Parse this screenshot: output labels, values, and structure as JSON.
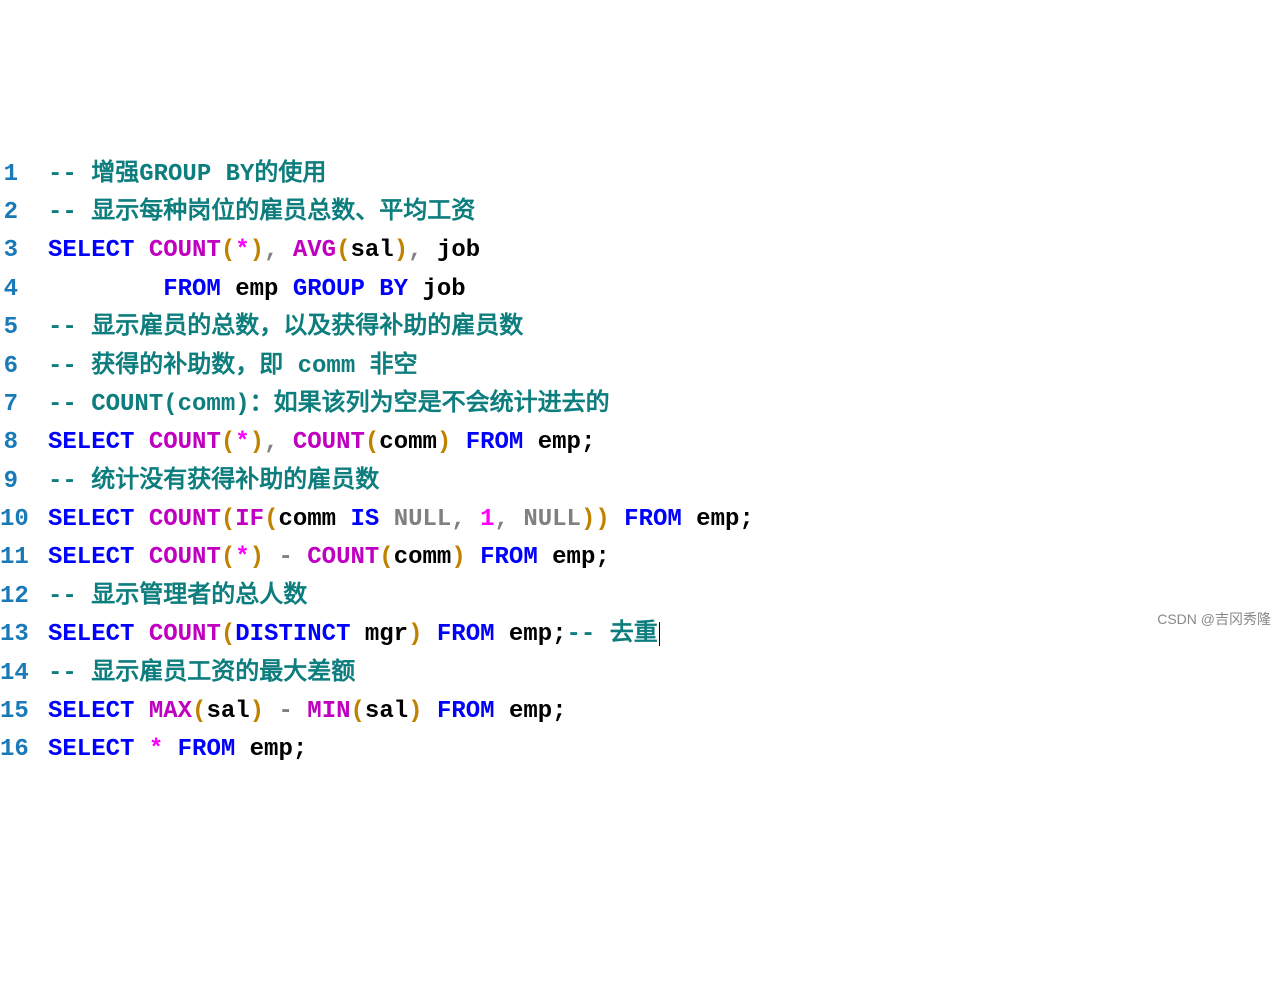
{
  "watermark": "CSDN @吉冈秀隆",
  "lines": [
    {
      "num": "1",
      "tokens": [
        {
          "cls": "comment",
          "t": "-- 增强GROUP BY的使用"
        }
      ]
    },
    {
      "num": "2",
      "tokens": [
        {
          "cls": "comment",
          "t": "-- 显示每种岗位的雇员总数、平均工资"
        }
      ]
    },
    {
      "num": "3",
      "tokens": [
        {
          "cls": "keyword",
          "t": "SELECT"
        },
        {
          "cls": "ident",
          "t": " "
        },
        {
          "cls": "func",
          "t": "COUNT"
        },
        {
          "cls": "paren",
          "t": "("
        },
        {
          "cls": "star",
          "t": "*"
        },
        {
          "cls": "paren",
          "t": ")"
        },
        {
          "cls": "op",
          "t": ", "
        },
        {
          "cls": "func",
          "t": "AVG"
        },
        {
          "cls": "paren",
          "t": "("
        },
        {
          "cls": "ident",
          "t": "sal"
        },
        {
          "cls": "paren",
          "t": ")"
        },
        {
          "cls": "op",
          "t": ", "
        },
        {
          "cls": "ident",
          "t": "job"
        }
      ]
    },
    {
      "num": "4",
      "tokens": [
        {
          "cls": "ident",
          "t": "        "
        },
        {
          "cls": "keyword",
          "t": "FROM"
        },
        {
          "cls": "ident",
          "t": " emp "
        },
        {
          "cls": "keyword",
          "t": "GROUP"
        },
        {
          "cls": "ident",
          "t": " "
        },
        {
          "cls": "keyword",
          "t": "BY"
        },
        {
          "cls": "ident",
          "t": " job"
        }
      ]
    },
    {
      "num": "5",
      "tokens": [
        {
          "cls": "comment",
          "t": "-- 显示雇员的总数，以及获得补助的雇员数"
        }
      ]
    },
    {
      "num": "6",
      "tokens": [
        {
          "cls": "comment",
          "t": "-- 获得的补助数，即 comm 非空"
        }
      ]
    },
    {
      "num": "7",
      "tokens": [
        {
          "cls": "comment",
          "t": "-- COUNT(comm)：如果该列为空是不会统计进去的"
        }
      ]
    },
    {
      "num": "8",
      "tokens": [
        {
          "cls": "keyword",
          "t": "SELECT"
        },
        {
          "cls": "ident",
          "t": " "
        },
        {
          "cls": "func",
          "t": "COUNT"
        },
        {
          "cls": "paren",
          "t": "("
        },
        {
          "cls": "star",
          "t": "*"
        },
        {
          "cls": "paren",
          "t": ")"
        },
        {
          "cls": "op",
          "t": ", "
        },
        {
          "cls": "func",
          "t": "COUNT"
        },
        {
          "cls": "paren",
          "t": "("
        },
        {
          "cls": "ident",
          "t": "comm"
        },
        {
          "cls": "paren",
          "t": ")"
        },
        {
          "cls": "ident",
          "t": " "
        },
        {
          "cls": "keyword",
          "t": "FROM"
        },
        {
          "cls": "ident",
          "t": " emp"
        },
        {
          "cls": "punct",
          "t": ";"
        }
      ]
    },
    {
      "num": "9",
      "tokens": [
        {
          "cls": "comment",
          "t": "-- 统计没有获得补助的雇员数"
        }
      ]
    },
    {
      "num": "10",
      "tokens": [
        {
          "cls": "keyword",
          "t": "SELECT"
        },
        {
          "cls": "ident",
          "t": " "
        },
        {
          "cls": "func",
          "t": "COUNT"
        },
        {
          "cls": "paren",
          "t": "("
        },
        {
          "cls": "func",
          "t": "IF"
        },
        {
          "cls": "paren",
          "t": "("
        },
        {
          "cls": "ident",
          "t": "comm "
        },
        {
          "cls": "keyword",
          "t": "IS"
        },
        {
          "cls": "ident",
          "t": " "
        },
        {
          "cls": "null",
          "t": "NULL"
        },
        {
          "cls": "op",
          "t": ", "
        },
        {
          "cls": "num",
          "t": "1"
        },
        {
          "cls": "op",
          "t": ", "
        },
        {
          "cls": "null",
          "t": "NULL"
        },
        {
          "cls": "paren",
          "t": "))"
        },
        {
          "cls": "ident",
          "t": " "
        },
        {
          "cls": "keyword",
          "t": "FROM"
        },
        {
          "cls": "ident",
          "t": " emp"
        },
        {
          "cls": "punct",
          "t": ";"
        }
      ]
    },
    {
      "num": "11",
      "tokens": [
        {
          "cls": "keyword",
          "t": "SELECT"
        },
        {
          "cls": "ident",
          "t": " "
        },
        {
          "cls": "func",
          "t": "COUNT"
        },
        {
          "cls": "paren",
          "t": "("
        },
        {
          "cls": "star",
          "t": "*"
        },
        {
          "cls": "paren",
          "t": ")"
        },
        {
          "cls": "ident",
          "t": " "
        },
        {
          "cls": "op",
          "t": "-"
        },
        {
          "cls": "ident",
          "t": " "
        },
        {
          "cls": "func",
          "t": "COUNT"
        },
        {
          "cls": "paren",
          "t": "("
        },
        {
          "cls": "ident",
          "t": "comm"
        },
        {
          "cls": "paren",
          "t": ")"
        },
        {
          "cls": "ident",
          "t": " "
        },
        {
          "cls": "keyword",
          "t": "FROM"
        },
        {
          "cls": "ident",
          "t": " emp"
        },
        {
          "cls": "punct",
          "t": ";"
        }
      ]
    },
    {
      "num": "12",
      "tokens": [
        {
          "cls": "comment",
          "t": "-- 显示管理者的总人数"
        }
      ]
    },
    {
      "num": "13",
      "tokens": [
        {
          "cls": "keyword",
          "t": "SELECT"
        },
        {
          "cls": "ident",
          "t": " "
        },
        {
          "cls": "func",
          "t": "COUNT"
        },
        {
          "cls": "paren",
          "t": "("
        },
        {
          "cls": "keyword",
          "t": "DISTINCT"
        },
        {
          "cls": "ident",
          "t": " mgr"
        },
        {
          "cls": "paren",
          "t": ")"
        },
        {
          "cls": "ident",
          "t": " "
        },
        {
          "cls": "keyword",
          "t": "FROM"
        },
        {
          "cls": "ident",
          "t": " emp"
        },
        {
          "cls": "punct",
          "t": ";"
        },
        {
          "cls": "comment",
          "t": "-- 去重"
        }
      ],
      "cursor": true
    },
    {
      "num": "14",
      "tokens": [
        {
          "cls": "comment",
          "t": "-- 显示雇员工资的最大差额"
        }
      ]
    },
    {
      "num": "15",
      "tokens": [
        {
          "cls": "keyword",
          "t": "SELECT"
        },
        {
          "cls": "ident",
          "t": " "
        },
        {
          "cls": "func",
          "t": "MAX"
        },
        {
          "cls": "paren",
          "t": "("
        },
        {
          "cls": "ident",
          "t": "sal"
        },
        {
          "cls": "paren",
          "t": ")"
        },
        {
          "cls": "ident",
          "t": " "
        },
        {
          "cls": "op",
          "t": "-"
        },
        {
          "cls": "ident",
          "t": " "
        },
        {
          "cls": "func",
          "t": "MIN"
        },
        {
          "cls": "paren",
          "t": "("
        },
        {
          "cls": "ident",
          "t": "sal"
        },
        {
          "cls": "paren",
          "t": ")"
        },
        {
          "cls": "ident",
          "t": " "
        },
        {
          "cls": "keyword",
          "t": "FROM"
        },
        {
          "cls": "ident",
          "t": " emp"
        },
        {
          "cls": "punct",
          "t": ";"
        }
      ]
    },
    {
      "num": "16",
      "tokens": [
        {
          "cls": "keyword",
          "t": "SELECT"
        },
        {
          "cls": "ident",
          "t": " "
        },
        {
          "cls": "star",
          "t": "*"
        },
        {
          "cls": "ident",
          "t": " "
        },
        {
          "cls": "keyword",
          "t": "FROM"
        },
        {
          "cls": "ident",
          "t": " emp"
        },
        {
          "cls": "punct",
          "t": ";"
        }
      ]
    }
  ]
}
